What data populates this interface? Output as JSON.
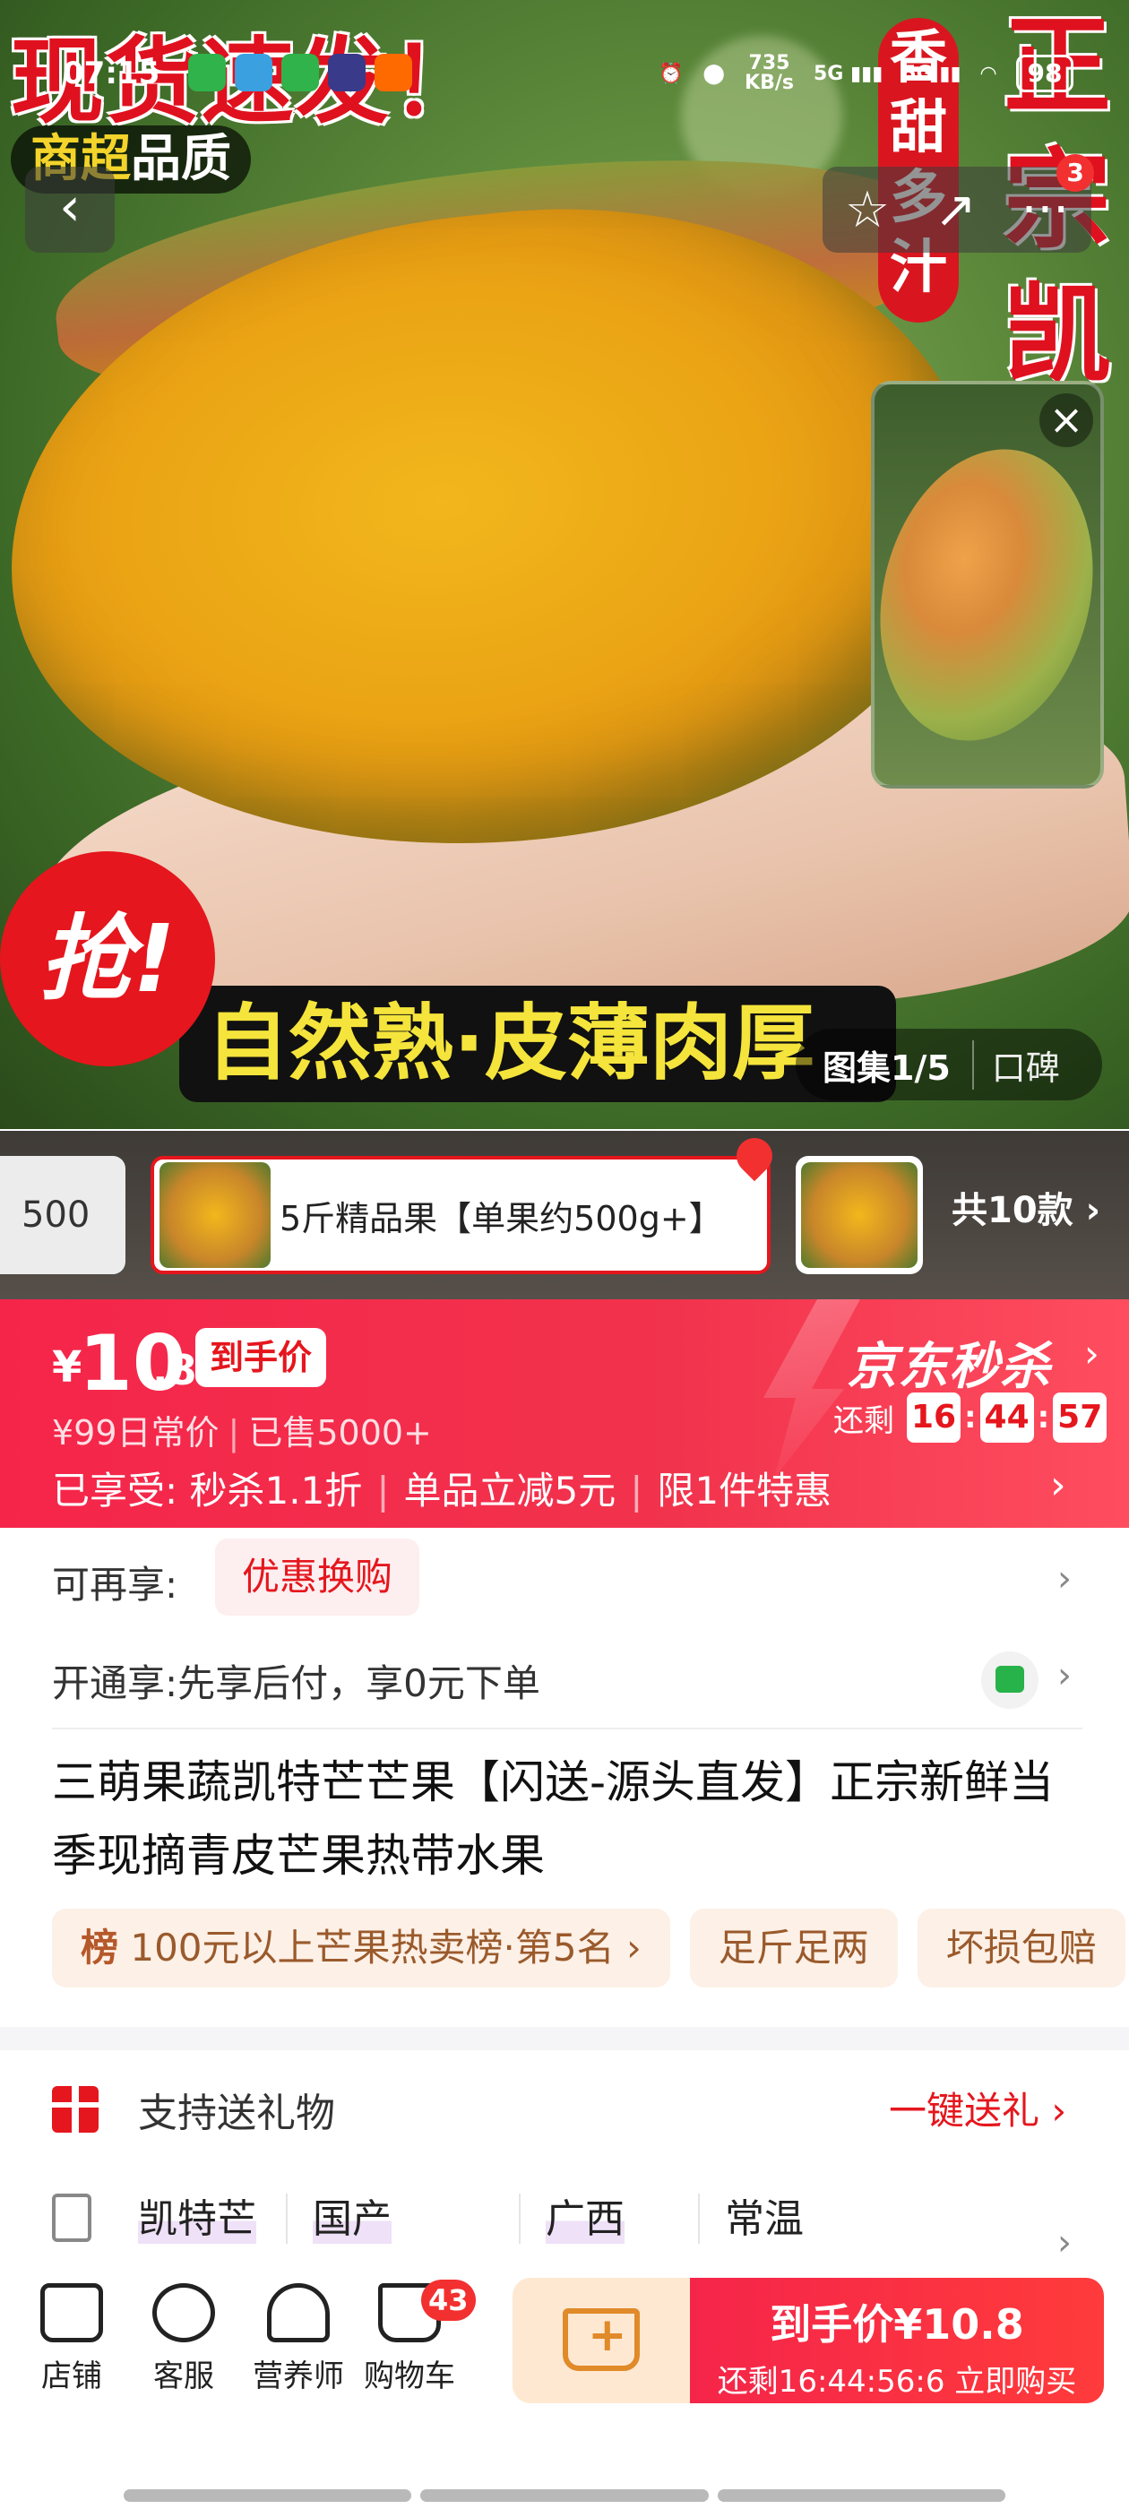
{
  "hero": {
    "headline": "现货速发！",
    "badge_yellow": "商超",
    "badge_white": "品质",
    "side_red": [
      "香",
      "甜",
      "多",
      "汁"
    ],
    "side_big": [
      "正",
      "宗",
      "凯"
    ],
    "qiang": "抢!",
    "banner": "自然熟·皮薄肉厚",
    "gallery": "图集1/5",
    "reviews": "口碑"
  },
  "status_bar": {
    "time": "07:15",
    "net_speed_value": "735",
    "net_speed_unit": "KB/s",
    "sim1": "5G",
    "sim2": "5G",
    "battery": "98"
  },
  "nav": {
    "back_glyph": "‹",
    "star_glyph": "☆",
    "share_glyph": "↗",
    "more_glyph": "···",
    "more_badge": "3",
    "close_glyph": "×"
  },
  "variants": {
    "prev_label": "500",
    "selected_label": "5斤精品果【单果约500g+】",
    "total": "共10款 ›"
  },
  "price": {
    "currency": "¥",
    "integer": "10",
    "decimal": ".8",
    "tag": "到手价",
    "daily": "¥99日常价",
    "sold": "已售5000+",
    "benefits_prefix": "已享受:",
    "benefit_1": "秒杀1.1折",
    "benefit_2": "单品立减5元",
    "benefit_3": "限1件特惠",
    "seckill": "京东秒杀",
    "countdown_label": "还剩",
    "countdown": [
      "16",
      "44",
      "57"
    ]
  },
  "rows": {
    "more_label": "可再享:",
    "more_pill": "优惠换购",
    "open_label": "开通享:先享后付，享0元下单"
  },
  "product": {
    "title": "三萌果蔬凯特芒芒果【闪送-源头直发】正宗新鲜当季现摘青皮芒果热带水果",
    "chips": [
      {
        "prefix": "榜",
        "text": " 100元以上芒果热卖榜·第5名 ›"
      },
      {
        "prefix": "",
        "text": "足斤足两"
      },
      {
        "prefix": "",
        "text": "坏损包赔"
      }
    ]
  },
  "gift": {
    "label": "支持送礼物",
    "action": "一键送礼 ›"
  },
  "attributes": [
    "凯特芒",
    "国产",
    "广西",
    "常温"
  ],
  "bottom": {
    "tabs": [
      "店铺",
      "客服",
      "营养师",
      "购物车"
    ],
    "cart_badge": "43",
    "buy_line1": "到手价¥10.8",
    "buy_line2": "还剩16:44:56:6 立即购买"
  }
}
